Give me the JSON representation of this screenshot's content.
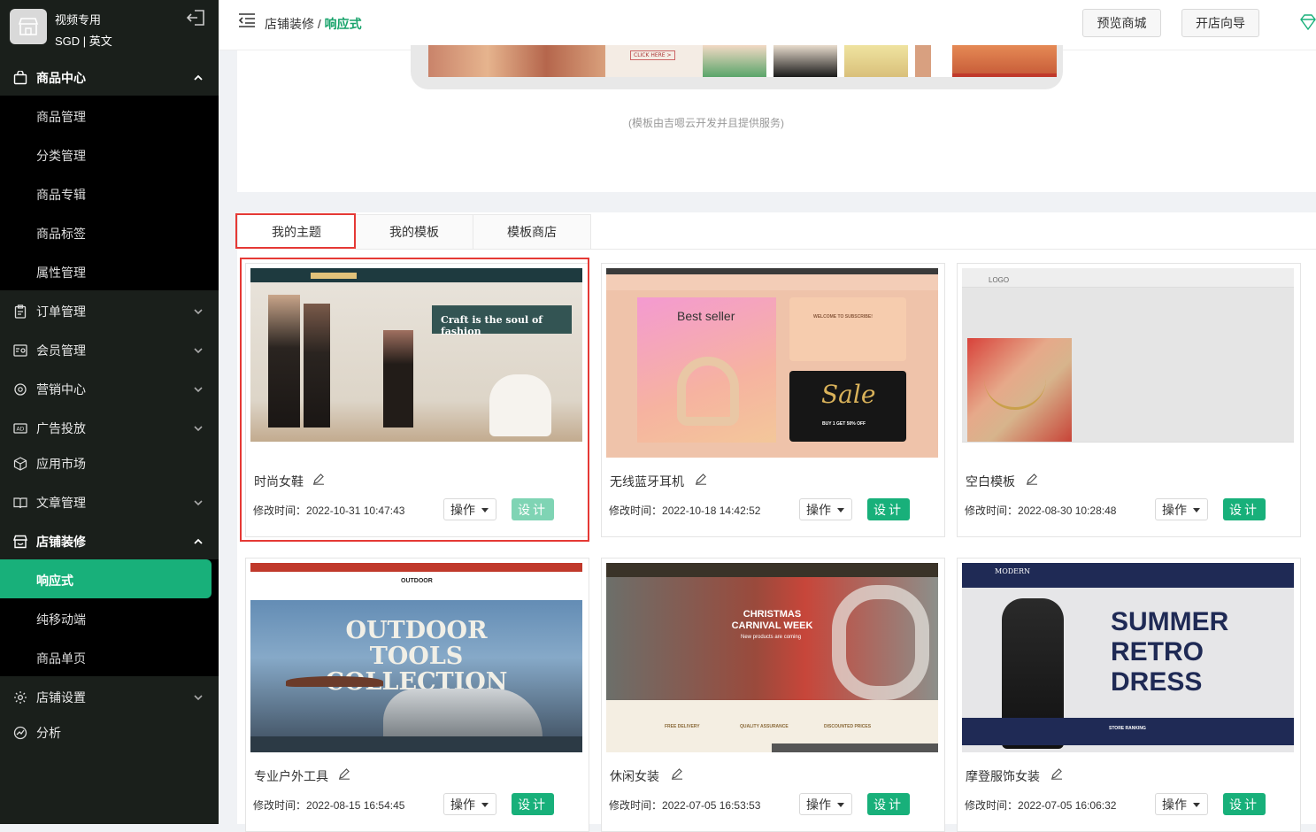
{
  "store": {
    "name": "视频专用",
    "meta": "SGD | 英文"
  },
  "sidebar": {
    "groups": [
      {
        "label": "商品中心",
        "children": [
          "商品管理",
          "分类管理",
          "商品专辑",
          "商品标签",
          "属性管理"
        ]
      },
      {
        "label": "订单管理"
      },
      {
        "label": "会员管理"
      },
      {
        "label": "营销中心"
      },
      {
        "label": "广告投放"
      },
      {
        "label": "应用市场"
      },
      {
        "label": "文章管理"
      },
      {
        "label": "店铺装修",
        "children": [
          "响应式",
          "纯移动端",
          "商品单页"
        ]
      },
      {
        "label": "店铺设置"
      },
      {
        "label": "分析"
      }
    ]
  },
  "header": {
    "breadcrumb_parent": "店铺装修",
    "breadcrumb_sep": "/",
    "breadcrumb_current": "响应式",
    "preview_button": "预览商城",
    "guide_button": "开店向导"
  },
  "banner": {
    "click_here": "CLICK HERE >",
    "provided_by": "(模板由吉嗯云开发并且提供服务)"
  },
  "tabs": [
    "我的主题",
    "我的模板",
    "模板商店"
  ],
  "cards": [
    {
      "name": "时尚女鞋",
      "time_label": "修改时间：",
      "time": "2022-10-31 10:47:43",
      "op": "操作",
      "design": "设计",
      "thumb_text": "Craft is the soul of fashion"
    },
    {
      "name": "无线蓝牙耳机",
      "time_label": "修改时间：",
      "time": "2022-10-18 14:42:52",
      "op": "操作",
      "design": "设计",
      "thumb_text": "Best seller"
    },
    {
      "name": "空白模板",
      "time_label": "修改时间：",
      "time": "2022-08-30 10:28:48",
      "op": "操作",
      "design": "设计",
      "thumb_text": "LOGO"
    },
    {
      "name": "专业户外工具",
      "time_label": "修改时间：",
      "time": "2022-08-15 16:54:45",
      "op": "操作",
      "design": "设计",
      "thumb_text": "OUTDOOR TOOLS COLLECTION"
    },
    {
      "name": "休闲女装",
      "time_label": "修改时间：",
      "time": "2022-07-05 16:53:53",
      "op": "操作",
      "design": "设计",
      "thumb_text": "CHRISTMAS CARNIVAL WEEK"
    },
    {
      "name": "摩登服饰女装",
      "time_label": "修改时间：",
      "time": "2022-07-05 16:06:32",
      "op": "操作",
      "design": "设计",
      "thumb_text": "SUMMER RETRO DRESS"
    }
  ],
  "thumb_extras": {
    "headphones_welcome": "WELCOME TO SUBSCRIBE!",
    "headphones_sale": "Sale",
    "headphones_offer": "BUY 1 GET 50% OFF",
    "outdoor_logo": "OUTDOOR",
    "casual_features": [
      "FREE DELIVERY",
      "QUALITY ASSURANCE",
      "DISCOUNTED PRICES"
    ],
    "casual_sub": "New products are coming",
    "modern_logo": "MODERN",
    "modern_ranking": "STORE RANKING"
  },
  "colors": {
    "accent": "#18b07a",
    "sidebar_bg": "#1a1f1b",
    "highlight": "#e53935"
  }
}
